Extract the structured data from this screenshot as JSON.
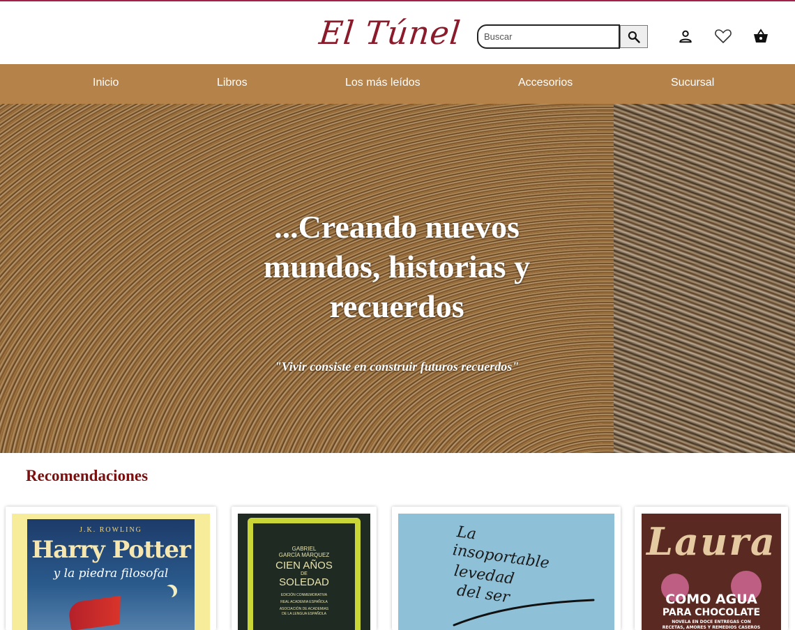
{
  "brand": {
    "logo_text": "El Túnel",
    "accent": "#a3204a",
    "nav_bg": "#b5824a",
    "title_color": "#7a1010"
  },
  "search": {
    "placeholder": "Buscar",
    "value": "",
    "button_icon": "search-icon"
  },
  "header_icons": [
    "user-icon",
    "heart-icon",
    "basket-icon"
  ],
  "nav": {
    "items": [
      "Inicio",
      "Libros",
      "Los más leídos",
      "Accesorios",
      "Sucursal"
    ]
  },
  "hero": {
    "headline": "...Creando nuevos mundos, historias y recuerdos",
    "quote": "\"Vivir consiste en construir futuros recuerdos\""
  },
  "recommendations": {
    "title": "Recomendaciones",
    "books": [
      {
        "cover_author": "J.K. ROWLING",
        "cover_title": "Harry Potter",
        "cover_subtitle": "y la piedra filosofal"
      },
      {
        "cover_author_line1": "GABRIEL",
        "cover_author_line2": "GARCÍA MÁRQUEZ",
        "cover_title_line1": "CIEN AÑOS",
        "cover_title_line2": "DE",
        "cover_title_line3": "SOLEDAD",
        "cover_note1": "EDICIÓN CONMEMORATIVA",
        "cover_note2": "REAL ACADEMIA ESPAÑOLA",
        "cover_note3": "ASOCIACIÓN DE ACADEMIAS",
        "cover_note4": "DE LA LENGUA ESPAÑOLA"
      },
      {
        "cover_line1": "La",
        "cover_line2": "insoportable",
        "cover_line3": "levedad",
        "cover_line4": "del ser"
      },
      {
        "cover_title": "Laura",
        "cover_sub1": "COMO AGUA",
        "cover_sub2": "PARA CHOCOLATE",
        "cover_small1": "NOVELA EN DOCE ENTREGAS CON",
        "cover_small2": "RECETAS, AMORES Y REMEDIOS CASEROS"
      }
    ]
  }
}
